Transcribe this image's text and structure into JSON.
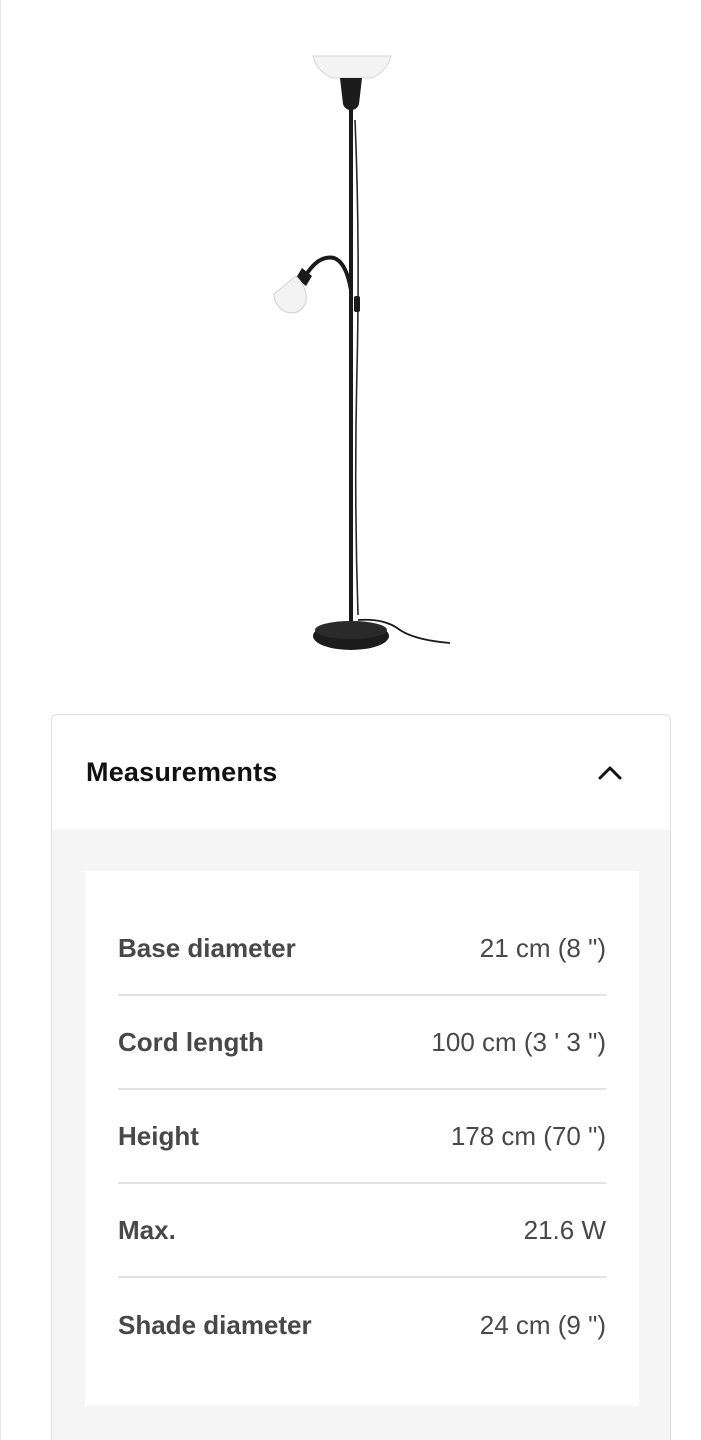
{
  "product": {
    "image_alt": "Floor uplighter with reading lamp, black/white"
  },
  "measurements": {
    "title": "Measurements",
    "expanded": true,
    "toggle_icon": "chevron-up-icon",
    "rows": [
      {
        "label": "Base diameter",
        "value": "21 cm (8 \")"
      },
      {
        "label": "Cord length",
        "value": "100 cm (3 ' 3 \")"
      },
      {
        "label": "Height",
        "value": "178 cm (70 \")"
      },
      {
        "label": "Max.",
        "value": "21.6 W"
      },
      {
        "label": "Shade diameter",
        "value": "24 cm (9 \")"
      }
    ]
  },
  "colors": {
    "text": "#111111",
    "muted_text": "#484848",
    "panel_bg": "#f5f5f5",
    "divider": "#e2e2e2"
  }
}
